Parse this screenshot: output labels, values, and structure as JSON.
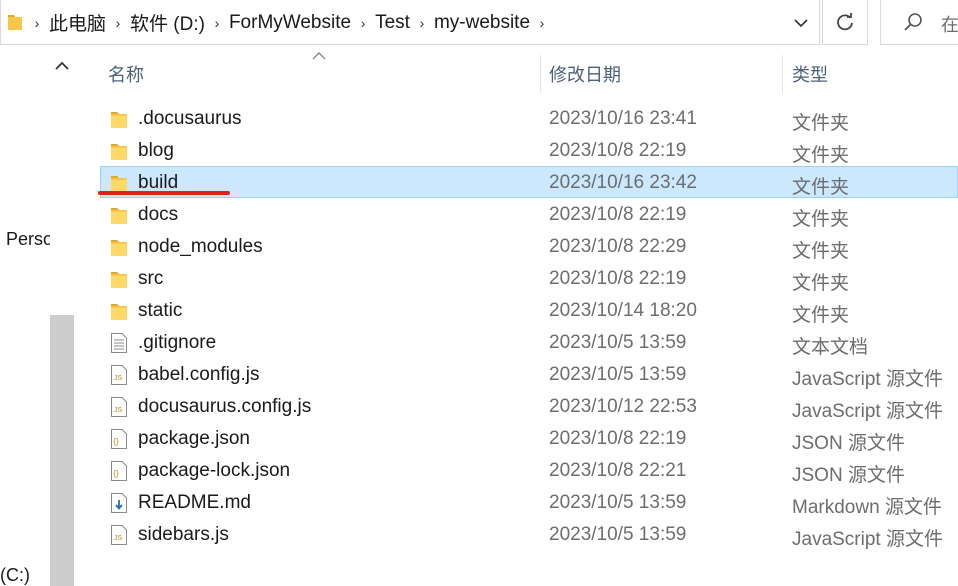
{
  "address_bar": {
    "crumbs": [
      "此电脑",
      "软件 (D:)",
      "ForMyWebsite",
      "Test",
      "my-website"
    ],
    "separator": "›"
  },
  "search": {
    "placeholder": "在"
  },
  "nav_pane": {
    "items": [
      {
        "label": "Perso"
      },
      {
        "label": "(C:)"
      }
    ]
  },
  "columns": {
    "name": "名称",
    "date": "修改日期",
    "type": "类型"
  },
  "files": [
    {
      "name": ".docusaurus",
      "date": "2023/10/16 23:41",
      "type": "文件夹",
      "icon": "folder"
    },
    {
      "name": "blog",
      "date": "2023/10/8 22:19",
      "type": "文件夹",
      "icon": "folder"
    },
    {
      "name": "build",
      "date": "2023/10/16 23:42",
      "type": "文件夹",
      "icon": "folder",
      "selected": true
    },
    {
      "name": "docs",
      "date": "2023/10/8 22:19",
      "type": "文件夹",
      "icon": "folder"
    },
    {
      "name": "node_modules",
      "date": "2023/10/8 22:29",
      "type": "文件夹",
      "icon": "folder"
    },
    {
      "name": "src",
      "date": "2023/10/8 22:19",
      "type": "文件夹",
      "icon": "folder"
    },
    {
      "name": "static",
      "date": "2023/10/14 18:20",
      "type": "文件夹",
      "icon": "folder"
    },
    {
      "name": ".gitignore",
      "date": "2023/10/5 13:59",
      "type": "文本文档",
      "icon": "text"
    },
    {
      "name": "babel.config.js",
      "date": "2023/10/5 13:59",
      "type": "JavaScript 源文件",
      "icon": "js"
    },
    {
      "name": "docusaurus.config.js",
      "date": "2023/10/12 22:53",
      "type": "JavaScript 源文件",
      "icon": "js"
    },
    {
      "name": "package.json",
      "date": "2023/10/8 22:19",
      "type": "JSON 源文件",
      "icon": "json"
    },
    {
      "name": "package-lock.json",
      "date": "2023/10/8 22:21",
      "type": "JSON 源文件",
      "icon": "json"
    },
    {
      "name": "README.md",
      "date": "2023/10/5 13:59",
      "type": "Markdown 源文件",
      "icon": "markdown"
    },
    {
      "name": "sidebars.js",
      "date": "2023/10/5 13:59",
      "type": "JavaScript 源文件",
      "icon": "js"
    }
  ],
  "colors": {
    "selection_bg": "#cce8ff",
    "selection_border": "#99d1ff",
    "folder_yellow": "#f8c74a",
    "annotation_red": "#e0201a",
    "header_text": "#4c607a"
  }
}
